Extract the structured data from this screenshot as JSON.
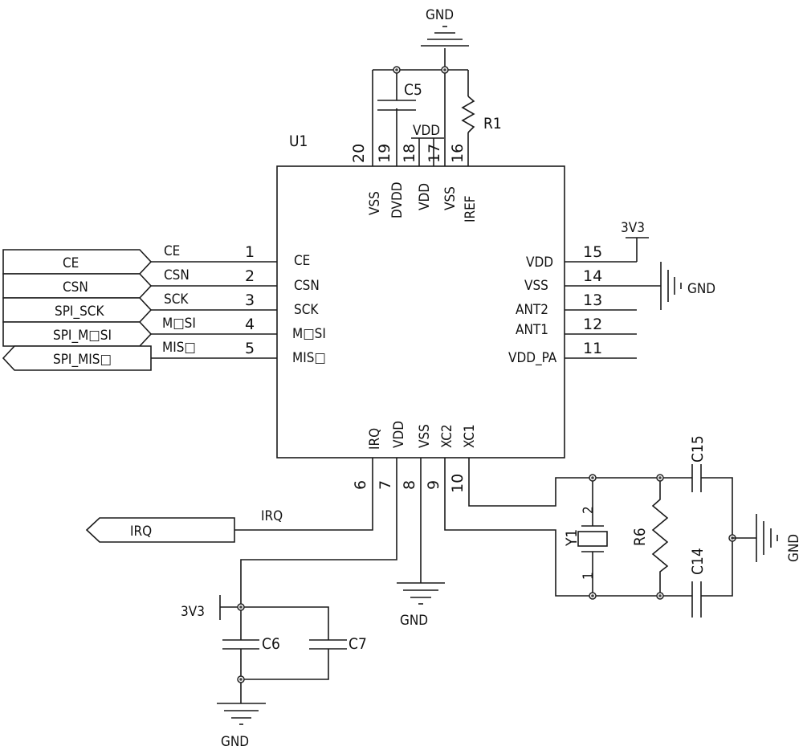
{
  "diagram": {
    "type": "electronic-schematic",
    "chip": {
      "refdes": "U1",
      "pins_left": [
        {
          "num": "1",
          "name": "CE",
          "net": "CE"
        },
        {
          "num": "2",
          "name": "CSN",
          "net": "CSN"
        },
        {
          "num": "3",
          "name": "SCK",
          "net": "SCK"
        },
        {
          "num": "4",
          "name": "M□SI",
          "net": "M□SI"
        },
        {
          "num": "5",
          "name": "MIS□",
          "net": "MIS□"
        }
      ],
      "pins_right": [
        {
          "num": "15",
          "name": "VDD"
        },
        {
          "num": "14",
          "name": "VSS"
        },
        {
          "num": "13",
          "name": "ANT2"
        },
        {
          "num": "12",
          "name": "ANT1"
        },
        {
          "num": "11",
          "name": "VDD_PA"
        }
      ],
      "pins_top": [
        {
          "num": "20",
          "name": "VSS"
        },
        {
          "num": "19",
          "name": "DVDD"
        },
        {
          "num": "18",
          "name": "VDD"
        },
        {
          "num": "17",
          "name": "VSS"
        },
        {
          "num": "16",
          "name": "IREF"
        }
      ],
      "pins_bottom": [
        {
          "num": "6",
          "name": "IRQ"
        },
        {
          "num": "7",
          "name": "VDD"
        },
        {
          "num": "8",
          "name": "VSS"
        },
        {
          "num": "9",
          "name": "XC2"
        },
        {
          "num": "10",
          "name": "XC1"
        }
      ]
    },
    "ports_left": [
      {
        "label": "CE",
        "direction": "in"
      },
      {
        "label": "CSN",
        "direction": "in"
      },
      {
        "label": "SPI_SCK",
        "direction": "in"
      },
      {
        "label": "SPI_M□SI",
        "direction": "in"
      },
      {
        "label": "SPI_MIS□",
        "direction": "out"
      }
    ],
    "irq": {
      "port_label": "IRQ",
      "net_label": "IRQ"
    },
    "components": {
      "c5": "C5",
      "r1": "R1",
      "c6": "C6",
      "c7": "C7",
      "y1": "Y1",
      "y1_pin1": "1",
      "y1_pin2": "2",
      "r6": "R6",
      "c14": "C14",
      "c15": "C15"
    },
    "power": {
      "gnd": "GND",
      "vdd": "VDD",
      "v3v3": "3V3"
    }
  }
}
